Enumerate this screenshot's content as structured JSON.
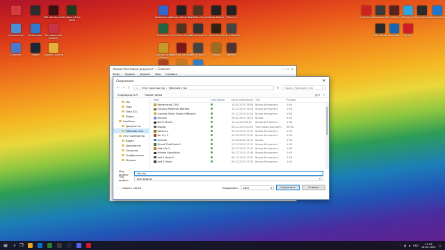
{
  "desktop_icons": [
    {
      "label": "",
      "color": "#d43b3b"
    },
    {
      "label": "",
      "color": "#2d2d2d"
    },
    {
      "label": "MSI Afterburner",
      "color": "#3a1010"
    },
    {
      "label": "Shadow of the Tomb",
      "color": "#1e3d20"
    },
    {
      "label": "Компьютер",
      "color": "#4a90d9"
    },
    {
      "label": "Фейерверк",
      "color": "#3377cc"
    },
    {
      "label": "Мгновенный ремонт",
      "color": "#cc3344"
    },
    {
      "label": "Блокнот",
      "color": "#4a7acc"
    },
    {
      "label": "Steam",
      "color": "#1b2838"
    },
    {
      "label": "Google Chrome",
      "color": "#e3b23c"
    },
    {
      "label": "Камера и др.",
      "color": "#3366cc"
    },
    {
      "label": "Hitman Absolution",
      "color": "#222222"
    },
    {
      "label": "The Elder Scrolls",
      "color": "#553322"
    },
    {
      "label": "Tomb Raider",
      "color": "#222222"
    },
    {
      "label": "Fallout 4",
      "color": "#222222"
    },
    {
      "label": "Sid Meier's",
      "color": "#226644"
    },
    {
      "label": "The Elder Scrolls",
      "color": "#553322"
    },
    {
      "label": "Borderlands 2",
      "color": "#333333"
    },
    {
      "label": "Dark Souls",
      "color": "#332211"
    },
    {
      "label": "Left 4 Dead 2",
      "color": "#444444"
    },
    {
      "label": "Counter-Strike Global",
      "color": "#c59a2a"
    },
    {
      "label": "Dead by Daylight",
      "color": "#7a1a1a"
    },
    {
      "label": "Left 4 Dead 1",
      "color": "#444444"
    },
    {
      "label": "Fallout",
      "color": "#9a6e22"
    },
    {
      "label": "Mafia III",
      "color": "#553333"
    },
    {
      "label": "Far Cry 5",
      "color": "#aa4422"
    },
    {
      "label": "Half-Life 2",
      "color": "#c77a22"
    },
    {
      "label": "Fortnite",
      "color": "#2e7ecc"
    },
    {
      "label": "Corel Draw",
      "color": "#cc2222"
    },
    {
      "label": "Dishonored",
      "color": "#3a3a3a"
    },
    {
      "label": "The Witcher 3",
      "color": "#5a2222"
    },
    {
      "label": "Telegram",
      "color": "#2da5e0"
    },
    {
      "label": "Epic Games",
      "color": "#2b2b2b"
    },
    {
      "label": "Microsoft Edge",
      "color": "#1e76d1"
    },
    {
      "label": "OBS Studio",
      "color": "#2b2b2b"
    },
    {
      "label": "Game Bar",
      "color": "#1a64b6"
    },
    {
      "label": "Opera",
      "color": "#d11a2a"
    }
  ],
  "notepad": {
    "title": "Новый текстовый документ — Блокнот",
    "menu": [
      "Файл",
      "Правка",
      "Формат",
      "Вид",
      "Справка"
    ]
  },
  "dialog": {
    "title": "Сохранение",
    "path_root": "Этот компьютер",
    "path_leaf": "Рабочий стол",
    "search_placeholder": "Поиск: Рабочий стол",
    "organize": "Упорядочить ▾",
    "new_folder": "Новая папка",
    "tree": [
      {
        "label": "cfg",
        "sub": true
      },
      {
        "label": "csgo",
        "sub": true
      },
      {
        "label": "Data (D:)",
        "sub": true
      },
      {
        "label": "Видео",
        "sub": true
      },
      {
        "label": "OneDrive",
        "sub": false
      },
      {
        "label": "Документы",
        "sub": true
      },
      {
        "label": "Рабочий стол",
        "sub": true,
        "selected": true
      },
      {
        "label": "Этот компьютер",
        "sub": false
      },
      {
        "label": "Видео",
        "sub": true
      },
      {
        "label": "Документы",
        "sub": true
      },
      {
        "label": "Загрузки",
        "sub": true
      },
      {
        "label": "Изображения",
        "sub": true
      },
      {
        "label": "Музыка",
        "sub": true
      }
    ],
    "columns": [
      "Имя",
      "Состояние",
      "Дата изменения",
      "Тип",
      "Размер"
    ],
    "files": [
      {
        "name": "Borderlands 2 RU",
        "date": "14.05.2020 18:09",
        "type": "Ярлык Интернета",
        "size": "1 КБ",
        "color": "#c8a034"
      },
      {
        "name": "Chivalry Medieval Warfare",
        "date": "14.12.2019 16:18",
        "type": "Ярлык Интернета",
        "size": "1 КБ",
        "color": "#7a5a3a"
      },
      {
        "name": "Counter-Strike Global Offensive",
        "date": "25.12.2019 20:23",
        "type": "Ярлык Интернета",
        "size": "1 КБ",
        "color": "#c59a2a"
      },
      {
        "name": "Discord",
        "date": "26.02.2020 14:12",
        "type": "Ярлык",
        "size": "3 КБ",
        "color": "#7289da"
      },
      {
        "name": "Don't Starve",
        "date": "15.12.2019 8:21",
        "type": "Ярлык Интернета",
        "size": "1 КБ",
        "color": "#2b2b2b"
      },
      {
        "name": "DsDbg",
        "date": "06.12.2019 20:19",
        "type": "Текстовый документ",
        "size": "96 КБ",
        "color": "#555555"
      },
      {
        "name": "Fallout 4",
        "date": "06.12.2019 19:41",
        "type": "Ярлык Интернета",
        "size": "1 КБ",
        "color": "#9a6e22"
      },
      {
        "name": "Far Cry 5",
        "date": "14.05.2020 13:47",
        "type": "Ярлык Интернета",
        "size": "1 КБ",
        "color": "#aa4422"
      },
      {
        "name": "Fortnite",
        "date": "15.04.2020 18:41",
        "type": "Ярлык",
        "size": "1 КБ",
        "color": "#2e7ecc"
      },
      {
        "name": "Grand Theft Auto V",
        "date": "27.12.2019 17:11",
        "type": "Ярлык Интернета",
        "size": "1 КБ",
        "color": "#3a7a3a"
      },
      {
        "name": "Half-Life 2",
        "date": "06.12.2019 17:44",
        "type": "Ярлык Интернета",
        "size": "1 КБ",
        "color": "#c77a22"
      },
      {
        "name": "Hitman Absolution",
        "date": "06.12.2019 17:48",
        "type": "Ярлык Интернета",
        "size": "1 КБ",
        "color": "#333333"
      },
      {
        "name": "Left 4 Dead 2",
        "date": "06.12.2019 17:50",
        "type": "Ярлык Интернета",
        "size": "1 КБ",
        "color": "#444444"
      },
      {
        "name": "Left 4 Dead",
        "date": "06.12.2019 17:50",
        "type": "Ярлык Интернета",
        "size": "1 КБ",
        "color": "#444444"
      }
    ],
    "filename_label": "Имя файла:",
    "filename_value": "cfg.cfg",
    "filetype_label": "Тип файла:",
    "filetype_value": "Все файлы",
    "hide_folders": "Скрыть папки",
    "encoding_label": "Кодировка:",
    "encoding_value": "ANSI",
    "save": "Сохранить",
    "cancel": "Отмена"
  },
  "taskbar": {
    "apps": [
      "#e8a628",
      "#0a73c9",
      "#2d7d32",
      "#3a3a3a",
      "#1b2838",
      "#5865f2",
      "#d11a2a"
    ],
    "lang": "ENG",
    "time": "21:06",
    "date": "16.05.2020"
  }
}
